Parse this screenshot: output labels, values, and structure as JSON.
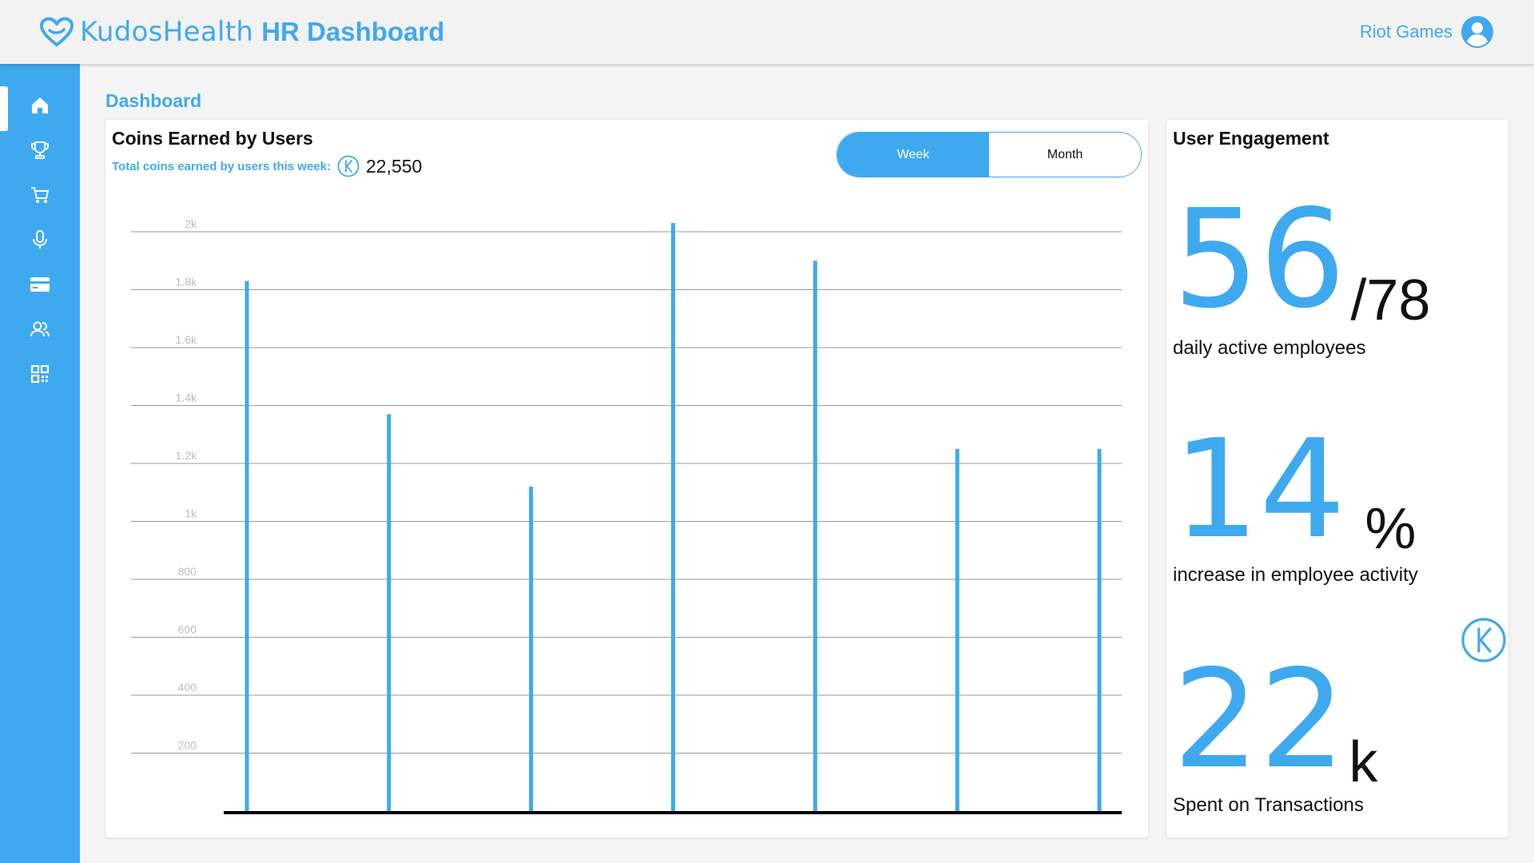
{
  "app": {
    "brand_light": "KudosHealth",
    "brand_bold": "HR Dashboard",
    "user_name": "Riot Games"
  },
  "icons": {
    "logo": "heart-logo-icon",
    "avatar": "user-avatar-icon",
    "sidebar": [
      "home-icon",
      "trophy-icon",
      "cart-icon",
      "microphone-icon",
      "credit-card-icon",
      "users-icon",
      "qr-code-icon"
    ],
    "coin": "kudos-coin-icon"
  },
  "colors": {
    "accent": "#3fa9f0",
    "text": "#111111",
    "background": "#f5f5f5"
  },
  "page": {
    "title": "Dashboard"
  },
  "coins_card": {
    "title": "Coins Earned by Users",
    "total_label": "Total coins earned by users this week:",
    "total_value": "22,550",
    "toggle": {
      "week": "Week",
      "month": "Month",
      "selected": "Week"
    }
  },
  "chart_data": {
    "type": "bar",
    "title": "Coins Earned by Users",
    "xlabel": "",
    "ylabel": "",
    "categories": [
      "",
      "",
      "",
      "",
      "",
      "",
      ""
    ],
    "values": [
      1830,
      1370,
      1120,
      2030,
      1900,
      1250,
      1250
    ],
    "y_ticks": [
      {
        "value": 200,
        "label": "200"
      },
      {
        "value": 400,
        "label": "400"
      },
      {
        "value": 600,
        "label": "600"
      },
      {
        "value": 800,
        "label": "800"
      },
      {
        "value": 1000,
        "label": "1k"
      },
      {
        "value": 1200,
        "label": "1.2k"
      },
      {
        "value": 1400,
        "label": "1.4k"
      },
      {
        "value": 1600,
        "label": "1.6k"
      },
      {
        "value": 1800,
        "label": "1.8k"
      },
      {
        "value": 2000,
        "label": "2k"
      }
    ],
    "ylim": [
      0,
      2000
    ],
    "grid": true,
    "color": "#3fa9f0"
  },
  "engagement": {
    "title": "User Engagement",
    "active": {
      "value": "56",
      "suffix": "/78",
      "label": "daily active employees"
    },
    "increase": {
      "value": "14",
      "suffix": "%",
      "label": "increase in employee activity"
    },
    "spent": {
      "value": "22",
      "suffix": "k",
      "label": "Spent on Transactions"
    }
  }
}
